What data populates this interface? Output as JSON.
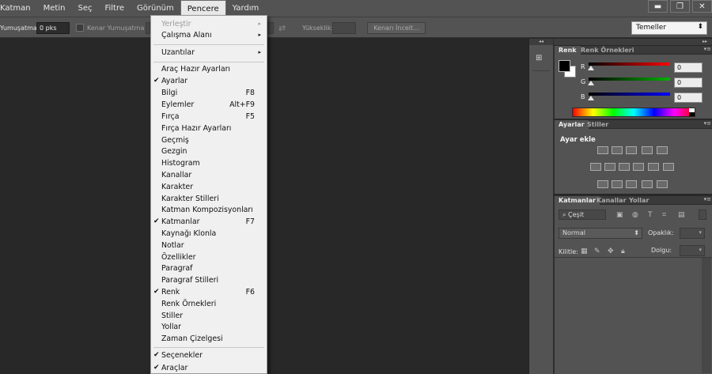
{
  "menubar": {
    "items": [
      "Katman",
      "Metin",
      "Seç",
      "Filtre",
      "Görünüm",
      "Pencere",
      "Yardım"
    ],
    "active_index": 5
  },
  "window_controls": {
    "minimize": "▬",
    "restore": "❐",
    "close": "✕"
  },
  "options_bar": {
    "feather_label": "Yumuşatma:",
    "feather_value": "0 pks",
    "anti_alias_label": "Kenar Yumuşatma",
    "height_label": "Yükseklik:",
    "refine_edge_label": "Kenarı İncelt...",
    "workspace_value": "Temeller"
  },
  "dropdown": {
    "items": [
      {
        "label": "Yerleştir",
        "disabled": true,
        "submenu": true
      },
      {
        "label": "Çalışma Alanı",
        "submenu": true
      },
      {
        "label": "Uzantılar",
        "submenu": true
      },
      {
        "label": "Araç Hazır Ayarları"
      },
      {
        "label": "Ayarlar",
        "checked": true
      },
      {
        "label": "Bilgi",
        "shortcut": "F8"
      },
      {
        "label": "Eylemler",
        "shortcut": "Alt+F9"
      },
      {
        "label": "Fırça",
        "shortcut": "F5"
      },
      {
        "label": "Fırça Hazır Ayarları"
      },
      {
        "label": "Geçmiş"
      },
      {
        "label": "Gezgin"
      },
      {
        "label": "Histogram"
      },
      {
        "label": "Kanallar"
      },
      {
        "label": "Karakter"
      },
      {
        "label": "Karakter Stilleri"
      },
      {
        "label": "Katman Kompozisyonları"
      },
      {
        "label": "Katmanlar",
        "checked": true,
        "shortcut": "F7"
      },
      {
        "label": "Kaynağı Klonla"
      },
      {
        "label": "Notlar"
      },
      {
        "label": "Özellikler"
      },
      {
        "label": "Paragraf"
      },
      {
        "label": "Paragraf Stilleri"
      },
      {
        "label": "Renk",
        "checked": true,
        "shortcut": "F6"
      },
      {
        "label": "Renk Örnekleri"
      },
      {
        "label": "Stiller"
      },
      {
        "label": "Yollar"
      },
      {
        "label": "Zaman Çizelgesi"
      },
      {
        "label": "Seçenekler",
        "checked": true
      },
      {
        "label": "Araçlar",
        "checked": true
      }
    ]
  },
  "color_panel": {
    "tabs": [
      "Renk",
      "Renk Örnekleri"
    ],
    "channels": [
      {
        "label": "R",
        "value": "0",
        "color": "#ff0000"
      },
      {
        "label": "G",
        "value": "0",
        "color": "#00b000"
      },
      {
        "label": "B",
        "value": "0",
        "color": "#0000ff"
      }
    ]
  },
  "adjustments_panel": {
    "tabs": [
      "Ayarlar",
      "Stiller"
    ],
    "title": "Ayar ekle"
  },
  "layers_panel": {
    "tabs": [
      "Katmanlar",
      "Kanallar",
      "Yollar"
    ],
    "filter_label": "Çeşit",
    "blend_mode": "Normal",
    "opacity_label": "Opaklık:",
    "lock_label": "Kilitle:",
    "fill_label": "Dolgu:"
  },
  "icons": {
    "check": "✔",
    "submenu": "▸",
    "collapse": "◂◂",
    "expand": "▸▸",
    "panel_menu": "▾≡"
  }
}
